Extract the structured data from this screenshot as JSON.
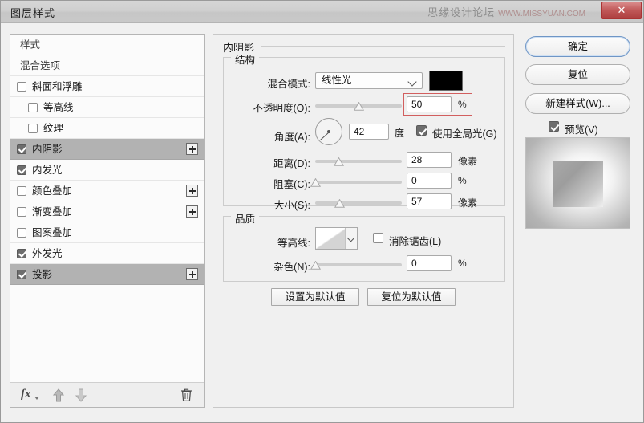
{
  "window": {
    "title": "图层样式",
    "watermark_text": "思缘设计论坛",
    "watermark_url": "WWW.MISSYUAN.COM",
    "close_label": "✕"
  },
  "styles_list": {
    "items": [
      {
        "label": "样式",
        "type": "header",
        "checkbox": "none",
        "checked": false,
        "selected": false,
        "plus": false,
        "indent": false
      },
      {
        "label": "混合选项",
        "type": "header",
        "checkbox": "none",
        "checked": false,
        "selected": false,
        "plus": false,
        "indent": false
      },
      {
        "label": "斜面和浮雕",
        "type": "item",
        "checkbox": "show",
        "checked": false,
        "selected": false,
        "plus": false,
        "indent": false
      },
      {
        "label": "等高线",
        "type": "sub",
        "checkbox": "show",
        "checked": false,
        "selected": false,
        "plus": false,
        "indent": true
      },
      {
        "label": "纹理",
        "type": "sub",
        "checkbox": "show",
        "checked": false,
        "selected": false,
        "plus": false,
        "indent": true
      },
      {
        "label": "内阴影",
        "type": "item",
        "checkbox": "show",
        "checked": true,
        "selected": true,
        "plus": true,
        "indent": false
      },
      {
        "label": "内发光",
        "type": "item",
        "checkbox": "show",
        "checked": true,
        "selected": false,
        "plus": false,
        "indent": false
      },
      {
        "label": "颜色叠加",
        "type": "item",
        "checkbox": "show",
        "checked": false,
        "selected": false,
        "plus": true,
        "indent": false
      },
      {
        "label": "渐变叠加",
        "type": "item",
        "checkbox": "show",
        "checked": false,
        "selected": false,
        "plus": true,
        "indent": false
      },
      {
        "label": "图案叠加",
        "type": "item",
        "checkbox": "show",
        "checked": false,
        "selected": false,
        "plus": false,
        "indent": false
      },
      {
        "label": "外发光",
        "type": "item",
        "checkbox": "show",
        "checked": true,
        "selected": false,
        "plus": false,
        "indent": false
      },
      {
        "label": "投影",
        "type": "item",
        "checkbox": "show",
        "checked": true,
        "selected": true,
        "plus": true,
        "indent": false
      }
    ],
    "toolbar": {
      "fx_label": "fx",
      "move_up": "move-up",
      "move_down": "move-down",
      "delete": "delete"
    }
  },
  "main": {
    "panel_title": "内阴影",
    "structure": {
      "group_label": "结构",
      "blend_mode": {
        "label": "混合模式:",
        "value": "线性光",
        "color": "#000000"
      },
      "opacity": {
        "label": "不透明度(O):",
        "value": "50",
        "unit": "%",
        "slider_pct": 50,
        "highlighted": true
      },
      "angle": {
        "label": "角度(A):",
        "value": "42",
        "unit": "度",
        "degrees": 42,
        "global_light": {
          "label": "使用全局光(G)",
          "checked": true
        }
      },
      "distance": {
        "label": "距离(D):",
        "value": "28",
        "unit": "像素",
        "slider_pct": 27
      },
      "choke": {
        "label": "阻塞(C):",
        "value": "0",
        "unit": "%",
        "slider_pct": 0
      },
      "size": {
        "label": "大小(S):",
        "value": "57",
        "unit": "像素",
        "slider_pct": 28
      }
    },
    "quality": {
      "group_label": "品质",
      "contour": {
        "label": "等高线:"
      },
      "anti_alias": {
        "label": "消除锯齿(L)",
        "checked": false
      },
      "noise": {
        "label": "杂色(N):",
        "value": "0",
        "unit": "%",
        "slider_pct": 0
      }
    },
    "buttons": {
      "set_default": "设置为默认值",
      "reset_default": "复位为默认值"
    }
  },
  "right": {
    "ok": "确定",
    "reset": "复位",
    "new_style": "新建样式(W)...",
    "preview": {
      "label": "预览(V)",
      "checked": true
    }
  }
}
